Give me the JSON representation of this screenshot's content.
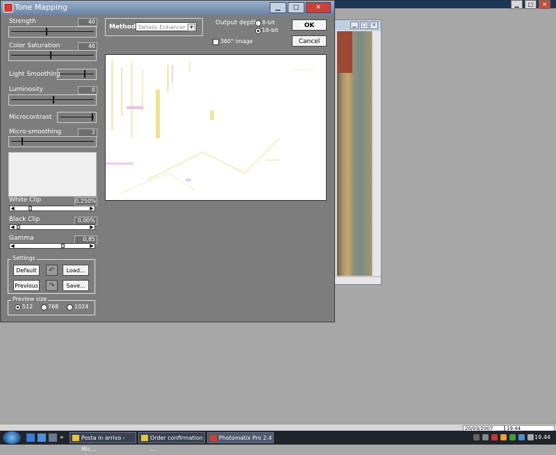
{
  "window_title": "Tone Mapping",
  "window_controls": {
    "minimize": "▁",
    "maximize": "□",
    "close": "✕"
  },
  "sliders": {
    "strength": {
      "label": "Strength",
      "value": "40"
    },
    "color_saturation": {
      "label": "Color Saturation",
      "value": "46"
    },
    "light_smoothing": {
      "label": "Light Smoothing"
    },
    "luminosity": {
      "label": "Luminosity",
      "value": "0"
    },
    "microcontrast": {
      "label": "Microcontrast"
    },
    "micro_smoothing": {
      "label": "Micro-smoothing",
      "value": "2"
    }
  },
  "clips": {
    "white_clip": {
      "label": "White Clip",
      "value": "0,250%"
    },
    "black_clip": {
      "label": "Black Clip",
      "value": "0,00%"
    },
    "gamma": {
      "label": "Gamma",
      "value": "0,85"
    }
  },
  "settings": {
    "title": "Settings",
    "default_label": "Default",
    "load_label": "Load...",
    "previous_label": "Previous",
    "save_label": "Save...",
    "undo_glyph": "↶",
    "redo_glyph": "↷"
  },
  "preview_size": {
    "title": "Preview size",
    "options": [
      "512",
      "768",
      "1024"
    ],
    "selected": "512"
  },
  "method": {
    "label": "Method:",
    "value": "Details Enhancer"
  },
  "output_depth": {
    "label": "Output depth:",
    "options": [
      "8-bit",
      "16-bit"
    ],
    "selected": "16-bit"
  },
  "image_360": {
    "label": "360° image",
    "checked": false
  },
  "ok_label": "OK",
  "cancel_label": "Cancel",
  "taskbar": {
    "tasks": [
      "Posta in arrivo - Mic...",
      "Order confirmation ...",
      "Photomatix Pro 2.4"
    ],
    "active_task": "Photomatix Pro 2.4",
    "clock": "19.44",
    "status_date": "20/03/2007",
    "status_time": "19.44"
  },
  "colors": {
    "dialog_bg": "#7d7d7d",
    "desktop_bg": "#a7a7a7",
    "taskbar_bg": "#20242b"
  }
}
